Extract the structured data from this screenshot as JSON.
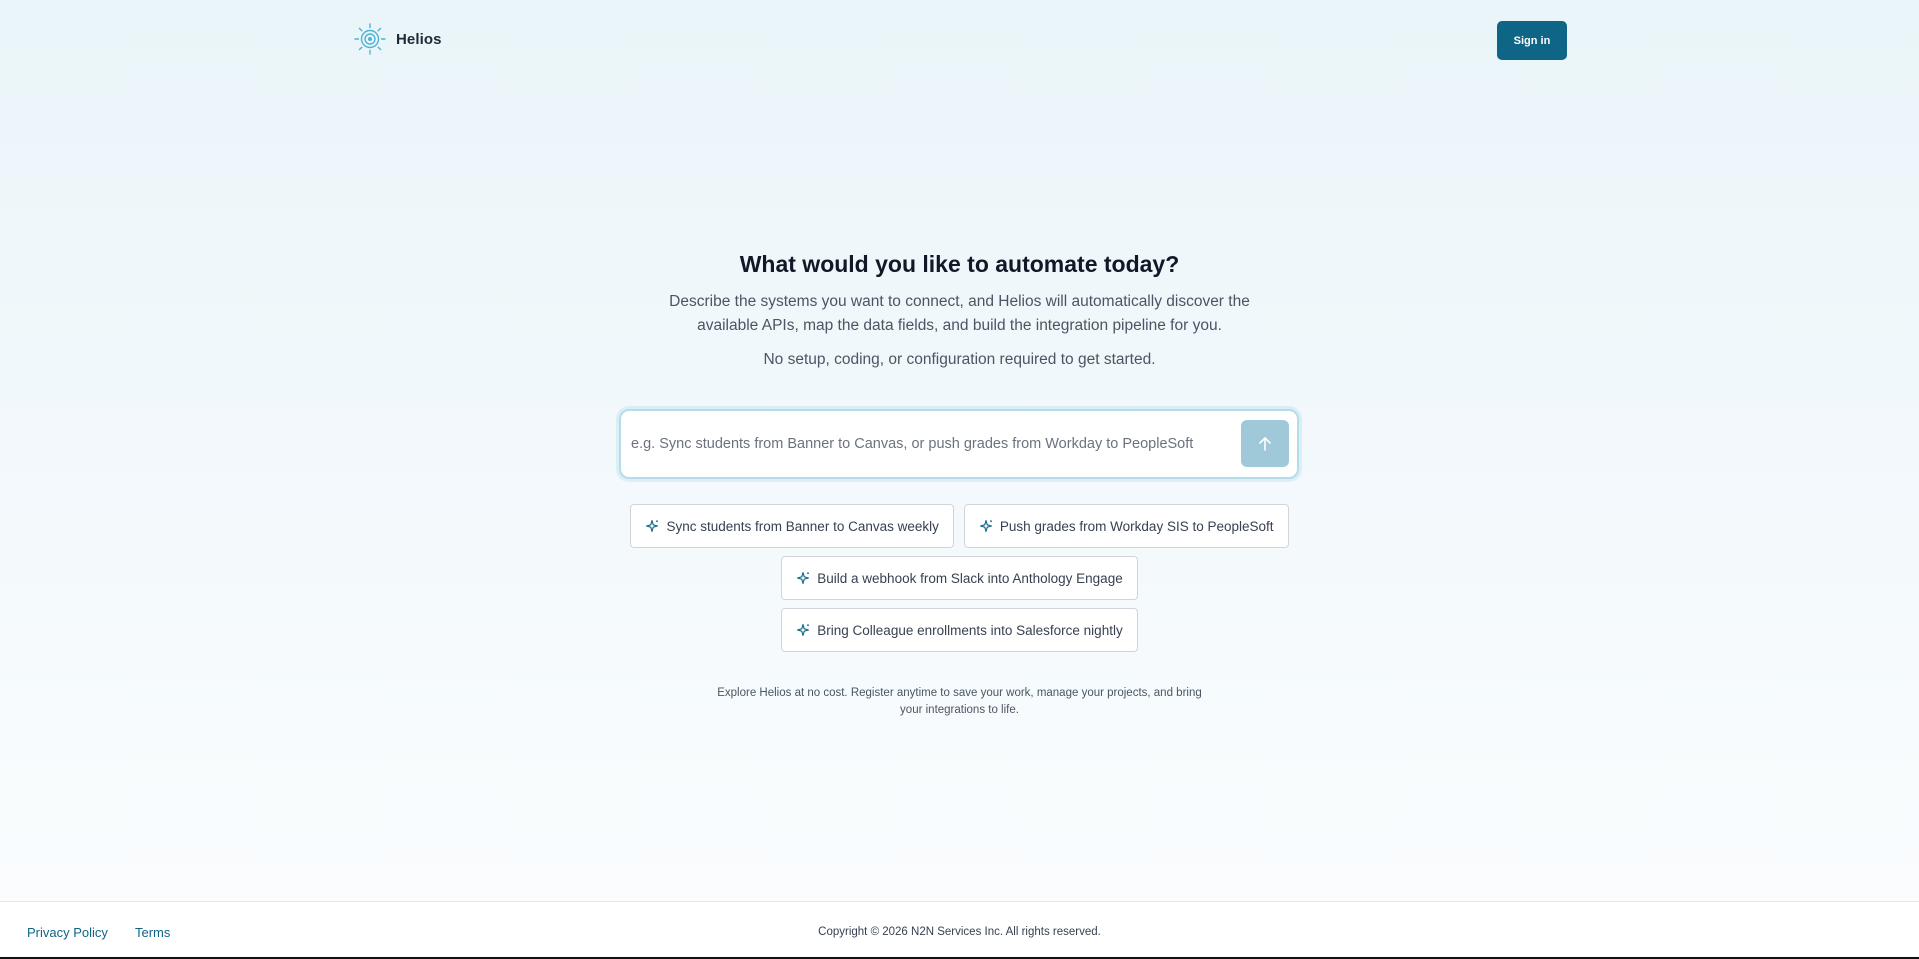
{
  "header": {
    "brand_name": "Helios",
    "sign_in_label": "Sign in"
  },
  "hero": {
    "title": "What would you like to automate today?",
    "description": "Describe the systems you want to connect, and Helios will automatically discover the available APIs, map the data fields, and build the integration pipeline for you.",
    "note": "No setup, coding, or configuration required to get started."
  },
  "prompt": {
    "placeholder": "e.g. Sync students from Banner to Canvas, or push grades from Workday to PeopleSoft",
    "value": "",
    "send_icon": "arrow-up-icon"
  },
  "suggestions": [
    {
      "label": "Sync students from Banner to Canvas weekly",
      "icon": "sparkle-icon"
    },
    {
      "label": "Push grades from Workday SIS to PeopleSoft",
      "icon": "sparkle-icon"
    },
    {
      "label": "Build a webhook from Slack into Anthology Engage",
      "icon": "sparkle-icon"
    },
    {
      "label": "Bring Colleague enrollments into Salesforce nightly",
      "icon": "sparkle-icon"
    }
  ],
  "explore_text": "Explore Helios at no cost. Register anytime to save your work, manage your projects, and bring your integrations to life.",
  "footer": {
    "privacy_label": "Privacy Policy",
    "terms_label": "Terms",
    "copyright": "Copyright © 2026 N2N Services Inc. All rights reserved."
  },
  "colors": {
    "brand": "#0f6585",
    "send_button_disabled": "#9fc9d8",
    "logo_accent": "#4fb3d1"
  }
}
